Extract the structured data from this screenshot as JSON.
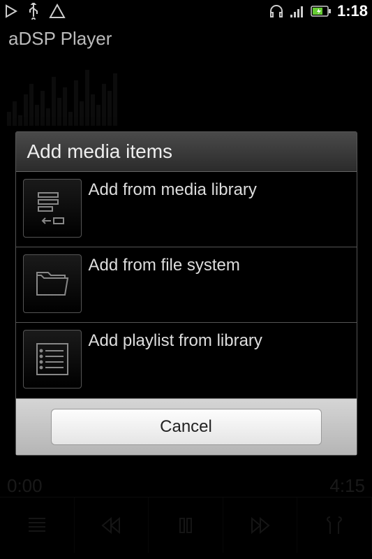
{
  "status": {
    "time": "1:18"
  },
  "app": {
    "title": "aDSP Player"
  },
  "playback": {
    "elapsed": "0:00",
    "total": "4:15"
  },
  "dialog": {
    "title": "Add media items",
    "items": [
      {
        "label": "Add from media library",
        "icon": "media-library-icon"
      },
      {
        "label": "Add from file system",
        "icon": "folder-icon"
      },
      {
        "label": "Add playlist from library",
        "icon": "playlist-icon"
      }
    ],
    "cancel_label": "Cancel"
  }
}
